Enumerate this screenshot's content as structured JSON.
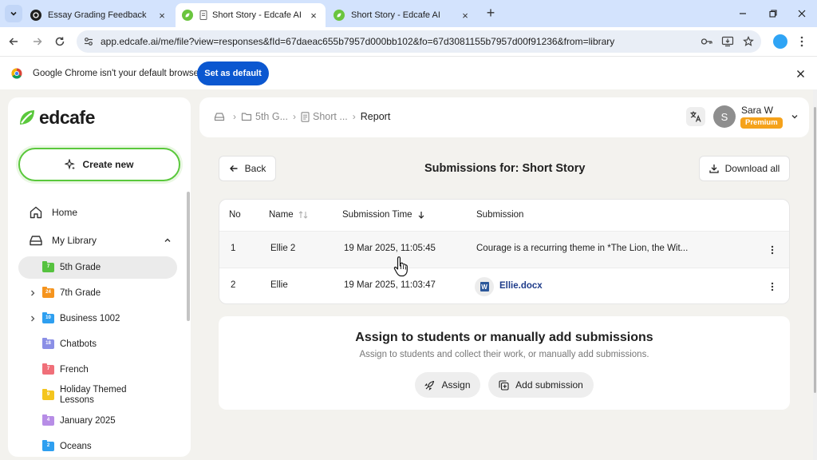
{
  "browser": {
    "tabs": [
      {
        "title": "Essay Grading Feedback",
        "active": false
      },
      {
        "title": "Short Story - Edcafe AI",
        "active": true
      },
      {
        "title": "Short Story - Edcafe AI",
        "active": false
      }
    ],
    "url": "app.edcafe.ai/me/file?view=responses&fId=67daeac655b7957d000bb102&fo=67d3081155b7957d00f91236&from=library",
    "infobar": {
      "message": "Google Chrome isn't your default browser",
      "button_label": "Set as default"
    }
  },
  "sidebar": {
    "logo_text": "edcafe",
    "create_label": "Create new",
    "nav": {
      "home_label": "Home",
      "library_label": "My Library"
    },
    "folders": [
      {
        "label": "5th Grade",
        "badge": "7",
        "color": "#56c23f",
        "selected": true,
        "expandable": false
      },
      {
        "label": "7th Grade",
        "badge": "24",
        "color": "#f5941e",
        "selected": false,
        "expandable": true
      },
      {
        "label": "Business 1002",
        "badge": "10",
        "color": "#2e9ff0",
        "selected": false,
        "expandable": true
      },
      {
        "label": "Chatbots",
        "badge": "18",
        "color": "#8b8fe6",
        "selected": false,
        "expandable": false
      },
      {
        "label": "French",
        "badge": "7",
        "color": "#f06f79",
        "selected": false,
        "expandable": false
      },
      {
        "label": "Holiday Themed Lessons",
        "badge": "9",
        "color": "#f4c51d",
        "selected": false,
        "expandable": false
      },
      {
        "label": "January 2025",
        "badge": "4",
        "color": "#b78de6",
        "selected": false,
        "expandable": false
      },
      {
        "label": "Oceans",
        "badge": "2",
        "color": "#2e9ff0",
        "selected": false,
        "expandable": false
      }
    ]
  },
  "header": {
    "breadcrumb": {
      "folder": "5th G...",
      "file": "Short ...",
      "current": "Report"
    },
    "user": {
      "initial": "S",
      "name": "Sara W",
      "badge": "Premium"
    }
  },
  "submissions": {
    "back_label": "Back",
    "title": "Submissions for: Short Story",
    "download_label": "Download all",
    "columns": {
      "no": "No",
      "name": "Name",
      "time": "Submission Time",
      "submission": "Submission"
    },
    "rows": [
      {
        "no": "1",
        "name": "Ellie 2",
        "time": "19 Mar 2025, 11:05:45",
        "submission": "Courage is a recurring theme in *The Lion, the Wit..."
      },
      {
        "no": "2",
        "name": "Ellie",
        "time": "19 Mar 2025, 11:03:47",
        "file": "Ellie.docx",
        "file_icon_letter": "W"
      }
    ]
  },
  "assign": {
    "title": "Assign to students or manually add submissions",
    "subtitle": "Assign to students and collect their work, or manually add submissions.",
    "assign_label": "Assign",
    "add_label": "Add submission"
  },
  "colors": {
    "brand_green": "#5ac83c",
    "premium": "#f5a21b",
    "chrome_blue": "#0b57d0",
    "file_link": "#1f3c8a"
  }
}
